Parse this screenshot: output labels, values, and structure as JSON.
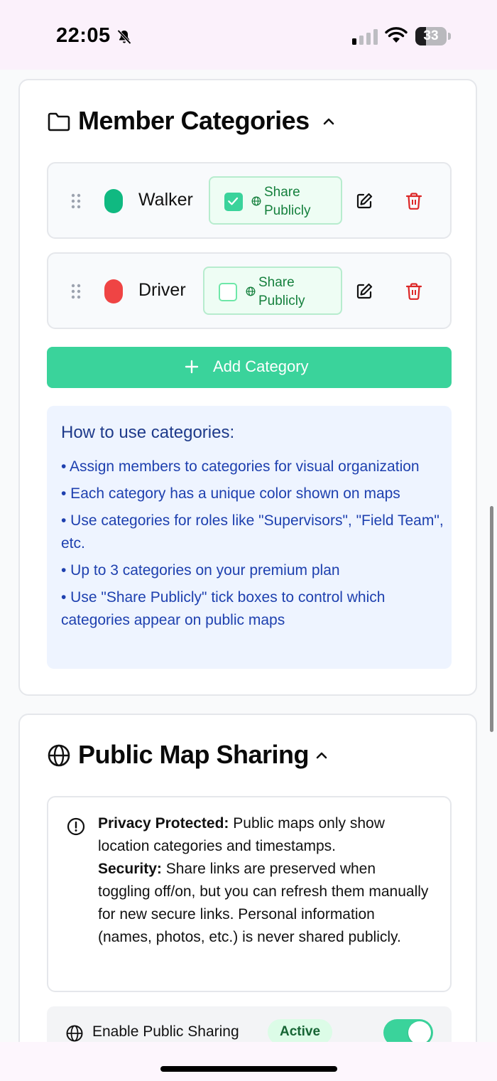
{
  "status_bar": {
    "time": "22:05",
    "battery": "33"
  },
  "member_categories": {
    "title": "Member Categories",
    "categories": [
      {
        "name": "Walker",
        "color": "#10b981",
        "share_label_line1": "Share",
        "share_label_line2": "Publicly",
        "share_checked": true
      },
      {
        "name": "Driver",
        "color": "#ef4444",
        "share_label_line1": "Share",
        "share_label_line2": "Publicly",
        "share_checked": false
      }
    ],
    "add_button_label": "Add Category",
    "help": {
      "title": "How to use categories:",
      "tips": [
        "• Assign members to categories for visual organization",
        "• Each category has a unique color shown on maps",
        "• Use categories for roles like \"Supervisors\", \"Field Team\", etc.",
        "• Up to 3 categories on your premium plan",
        "• Use \"Share Publicly\" tick boxes to control which categories appear on public maps"
      ]
    }
  },
  "public_map_sharing": {
    "title": "Public Map Sharing",
    "privacy_label": "Privacy Protected:",
    "privacy_text": " Public maps only show location categories and timestamps.",
    "security_label": "Security:",
    "security_text": " Share links are preserved when toggling off/on, but you can refresh them manually for new secure links. Personal information (names, photos, etc.) is never shared publicly.",
    "enable_label": "Enable Public Sharing",
    "status_badge": "Active",
    "enabled": true
  },
  "colors": {
    "accent": "#3ad39b",
    "danger": "#dc2626",
    "info_bg": "#eef4ff",
    "info_text": "#1e40af"
  },
  "icons": [
    "bell-slash-icon",
    "signal-icon",
    "wifi-icon",
    "folder-icon",
    "chevron-up-icon",
    "drag-handle-icon",
    "globe-icon",
    "edit-icon",
    "trash-icon",
    "plus-icon",
    "alert-circle-icon"
  ]
}
